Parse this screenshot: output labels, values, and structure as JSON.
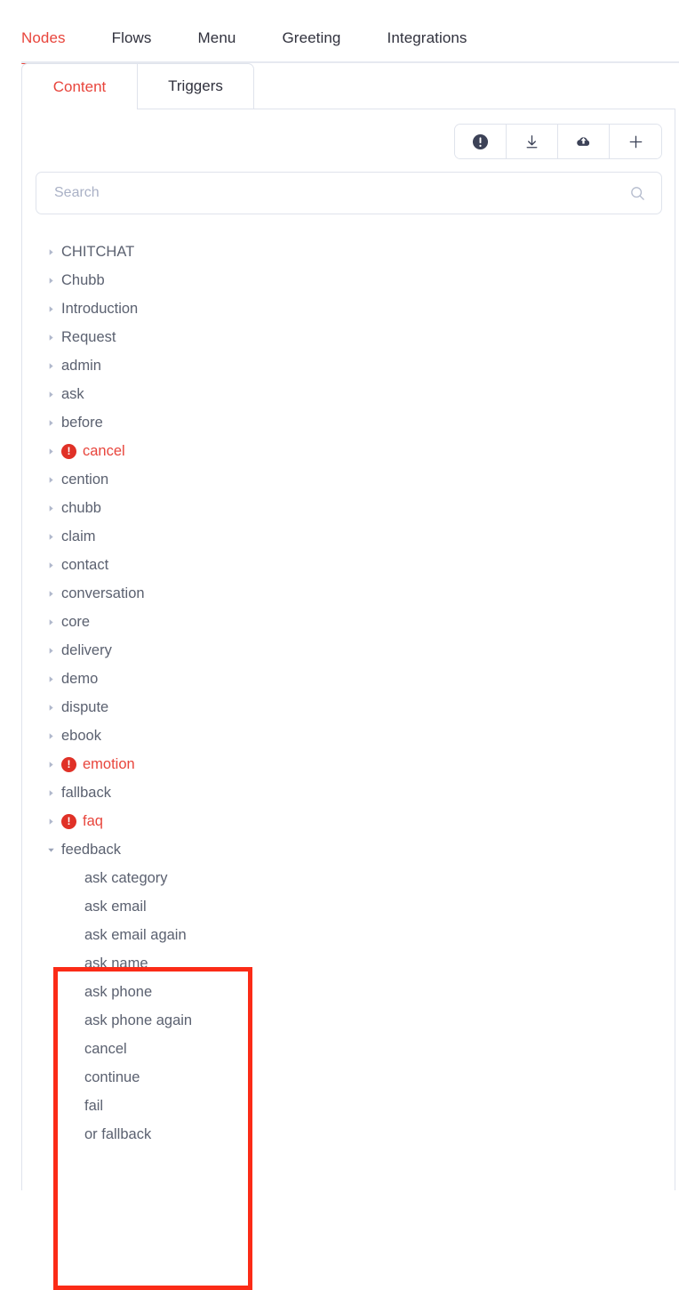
{
  "topnav": {
    "items": [
      {
        "label": "Nodes",
        "active": true
      },
      {
        "label": "Flows",
        "active": false
      },
      {
        "label": "Menu",
        "active": false
      },
      {
        "label": "Greeting",
        "active": false
      },
      {
        "label": "Integrations",
        "active": false
      }
    ]
  },
  "tabs": [
    {
      "label": "Content",
      "active": true
    },
    {
      "label": "Triggers",
      "active": false
    }
  ],
  "toolbar": {
    "buttons": [
      {
        "icon": "alert-circle-icon",
        "label": "Errors"
      },
      {
        "icon": "download-icon",
        "label": "Download"
      },
      {
        "icon": "cloud-upload-icon",
        "label": "Upload"
      },
      {
        "icon": "plus-icon",
        "label": "Add"
      }
    ]
  },
  "search": {
    "value": "",
    "placeholder": "Search",
    "icon": "search-icon"
  },
  "tree": {
    "nodes": [
      {
        "label": "CHITCHAT",
        "expanded": false,
        "error": false,
        "child": false
      },
      {
        "label": "Chubb",
        "expanded": false,
        "error": false,
        "child": false
      },
      {
        "label": "Introduction",
        "expanded": false,
        "error": false,
        "child": false
      },
      {
        "label": "Request",
        "expanded": false,
        "error": false,
        "child": false
      },
      {
        "label": "admin",
        "expanded": false,
        "error": false,
        "child": false
      },
      {
        "label": "ask",
        "expanded": false,
        "error": false,
        "child": false
      },
      {
        "label": "before",
        "expanded": false,
        "error": false,
        "child": false
      },
      {
        "label": "cancel",
        "expanded": false,
        "error": true,
        "child": false
      },
      {
        "label": "cention",
        "expanded": false,
        "error": false,
        "child": false
      },
      {
        "label": "chubb",
        "expanded": false,
        "error": false,
        "child": false
      },
      {
        "label": "claim",
        "expanded": false,
        "error": false,
        "child": false
      },
      {
        "label": "contact",
        "expanded": false,
        "error": false,
        "child": false
      },
      {
        "label": "conversation",
        "expanded": false,
        "error": false,
        "child": false
      },
      {
        "label": "core",
        "expanded": false,
        "error": false,
        "child": false
      },
      {
        "label": "delivery",
        "expanded": false,
        "error": false,
        "child": false
      },
      {
        "label": "demo",
        "expanded": false,
        "error": false,
        "child": false
      },
      {
        "label": "dispute",
        "expanded": false,
        "error": false,
        "child": false
      },
      {
        "label": "ebook",
        "expanded": false,
        "error": false,
        "child": false
      },
      {
        "label": "emotion",
        "expanded": false,
        "error": true,
        "child": false
      },
      {
        "label": "fallback",
        "expanded": false,
        "error": false,
        "child": false
      },
      {
        "label": "faq",
        "expanded": false,
        "error": true,
        "child": false
      },
      {
        "label": "feedback",
        "expanded": true,
        "error": false,
        "child": false
      },
      {
        "label": "ask category",
        "expanded": false,
        "error": false,
        "child": true
      },
      {
        "label": "ask email",
        "expanded": false,
        "error": false,
        "child": true
      },
      {
        "label": "ask email again",
        "expanded": false,
        "error": false,
        "child": true
      },
      {
        "label": "ask name",
        "expanded": false,
        "error": false,
        "child": true
      },
      {
        "label": "ask phone",
        "expanded": false,
        "error": false,
        "child": true
      },
      {
        "label": "ask phone again",
        "expanded": false,
        "error": false,
        "child": true
      },
      {
        "label": "cancel",
        "expanded": false,
        "error": false,
        "child": true
      },
      {
        "label": "continue",
        "expanded": false,
        "error": false,
        "child": true
      },
      {
        "label": "fail",
        "expanded": false,
        "error": false,
        "child": true
      },
      {
        "label": "or fallback",
        "expanded": false,
        "error": false,
        "child": true
      }
    ]
  },
  "annotation": {
    "color": "#fb2b17",
    "target": "feedback"
  },
  "colors": {
    "accent": "#e8453c",
    "error": "#e03127",
    "border": "#dfe3ec",
    "text": "#5b6170",
    "placeholder": "#aab1c6"
  }
}
